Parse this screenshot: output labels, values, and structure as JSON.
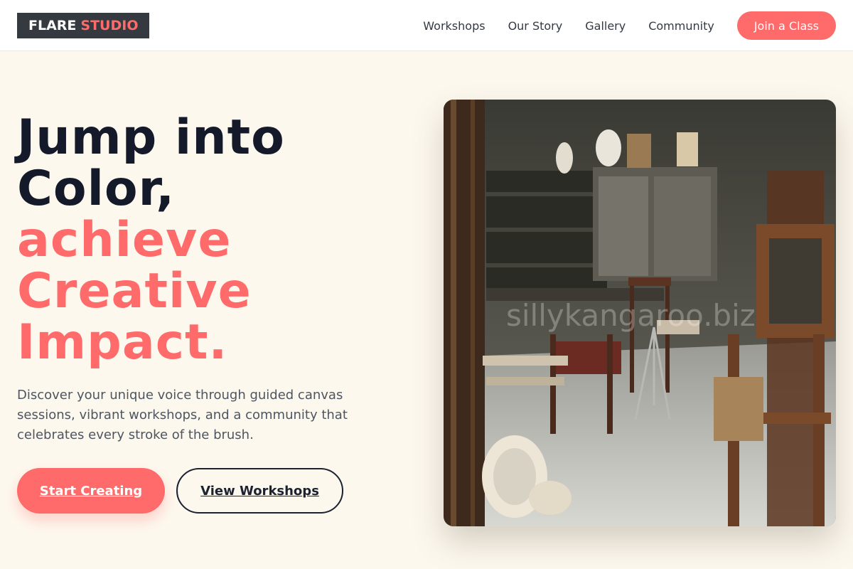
{
  "brand": {
    "word1": "FLARE",
    "word2": "STUDIO"
  },
  "nav": {
    "items": [
      "Workshops",
      "Our Story",
      "Gallery",
      "Community"
    ],
    "cta": "Join a Class"
  },
  "hero": {
    "title_dark": [
      "Jump into",
      "Color,"
    ],
    "title_accent": [
      "achieve",
      "Creative",
      "Impact."
    ],
    "description": "Discover your unique voice through guided canvas sessions, vibrant workshops, and a community that celebrates every stroke of the brush.",
    "primary_button": "Start Creating",
    "secondary_button": "View Workshops"
  },
  "image": {
    "watermark": "sillykangaroo.biz"
  },
  "colors": {
    "accent": "#ff6b6b",
    "dark": "#141a2a",
    "background": "#fdf8ee",
    "logo_bg": "#343a3f"
  }
}
